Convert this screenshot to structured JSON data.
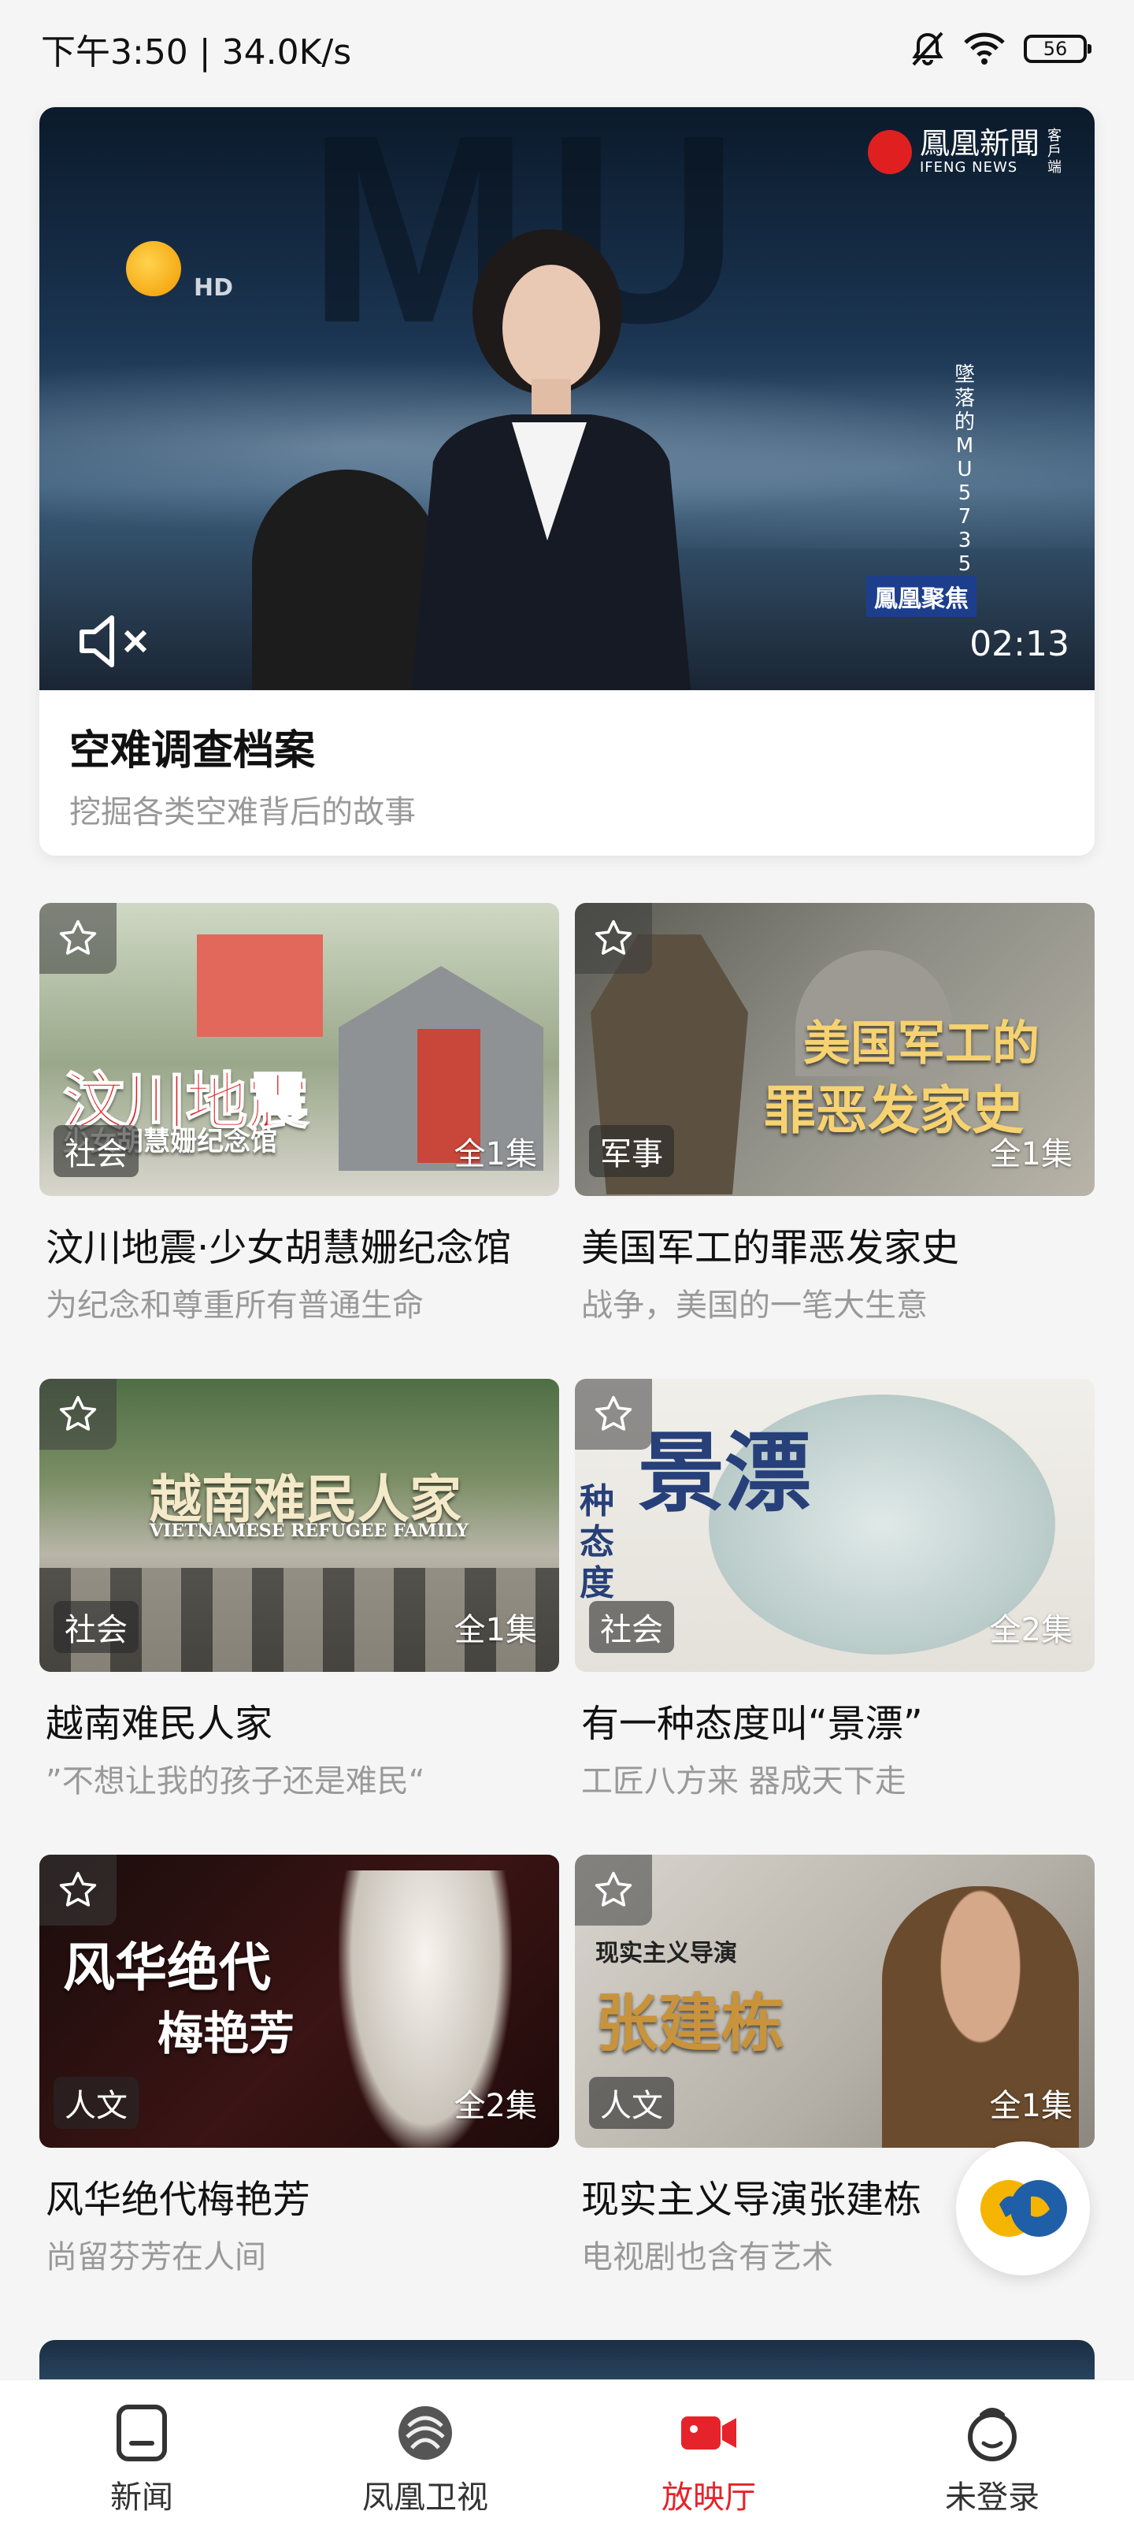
{
  "status": {
    "time_speed": "下午3:50 | 34.0K/s",
    "battery": "56"
  },
  "hero": {
    "title": "空难调查档案",
    "subtitle": "挖掘各类空难背后的故事",
    "duration": "02:13",
    "hd": "HD",
    "brand_name": "鳳凰新聞",
    "brand_sub": "IFENG NEWS",
    "brand_side": "客戶端",
    "vertical_text": "墜落的MU5735",
    "show_tag": "鳳凰聚焦",
    "muted": true
  },
  "cards": [
    {
      "title": "汶川地震·少女胡慧姗纪念馆",
      "subtitle": "为纪念和尊重所有普通生命",
      "category": "社会",
      "episodes": "全1集",
      "thumb_text": "汶川地震",
      "thumb_sub": "少女胡慧姗纪念馆"
    },
    {
      "title": "美国军工的罪恶发家史",
      "subtitle": "战争，美国的一笔大生意",
      "category": "军事",
      "episodes": "全1集",
      "thumb_text": "美国军工的",
      "thumb_sub": "罪恶发家史"
    },
    {
      "title": "越南难民人家",
      "subtitle": "”不想让我的孩子还是难民“",
      "category": "社会",
      "episodes": "全1集",
      "thumb_text": "越南难民人家",
      "thumb_sub": "VIETNAMESE REFUGEE FAMILY"
    },
    {
      "title": "有一种态度叫“景漂”",
      "subtitle": "工匠八方来 器成天下走",
      "category": "社会",
      "episodes": "全2集",
      "thumb_text": "景漂",
      "thumb_sub": "种态度"
    },
    {
      "title": "风华绝代梅艳芳",
      "subtitle": "尚留芬芳在人间",
      "category": "人文",
      "episodes": "全2集",
      "thumb_text": "风华绝代",
      "thumb_sub": "梅艳芳"
    },
    {
      "title": "现实主义导演张建栋",
      "subtitle": "电视剧也含有艺术",
      "category": "人文",
      "episodes": "全1集",
      "thumb_text": "张建栋",
      "thumb_sub": "现实主义导演"
    }
  ],
  "nav": [
    {
      "label": "新闻",
      "icon": "news-icon"
    },
    {
      "label": "凤凰卫视",
      "icon": "phoenix-tv-icon"
    },
    {
      "label": "放映厅",
      "icon": "video-camera-icon",
      "active": true
    },
    {
      "label": "未登录",
      "icon": "user-avatar-icon"
    }
  ],
  "colors": {
    "accent": "#e5232a",
    "muted_text": "#999999"
  }
}
